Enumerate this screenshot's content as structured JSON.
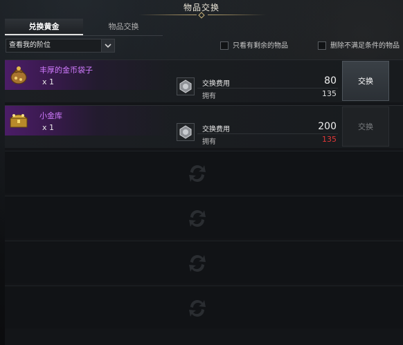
{
  "window": {
    "title": "物品交换"
  },
  "tabs": [
    {
      "label": "兑换黄金",
      "active": true
    },
    {
      "label": "物品交换",
      "active": false
    }
  ],
  "filter": {
    "selected": "查看我的阶位",
    "icon": "chevron-down-icon"
  },
  "checkboxes": [
    {
      "label": "只看有剩余的物品",
      "checked": false
    },
    {
      "label": "删除不满足条件的物品",
      "checked": false
    }
  ],
  "items": [
    {
      "name": "丰厚的金币袋子",
      "qty": "x 1",
      "icon": "coin-bag-icon",
      "cost_label": "交换费用",
      "cost_value": "80",
      "own_label": "拥有",
      "own_value": "135",
      "own_sufficient": true,
      "button": "交换",
      "button_enabled": true
    },
    {
      "name": "小金库",
      "qty": "x 1",
      "icon": "treasure-chest-icon",
      "cost_label": "交换费用",
      "cost_value": "200",
      "own_label": "拥有",
      "own_value": "135",
      "own_sufficient": false,
      "button": "交换",
      "button_enabled": false
    }
  ],
  "colors": {
    "item_name": "#d17bff",
    "insufficient": "#e53838",
    "banner_purple": "#4b1d67"
  }
}
